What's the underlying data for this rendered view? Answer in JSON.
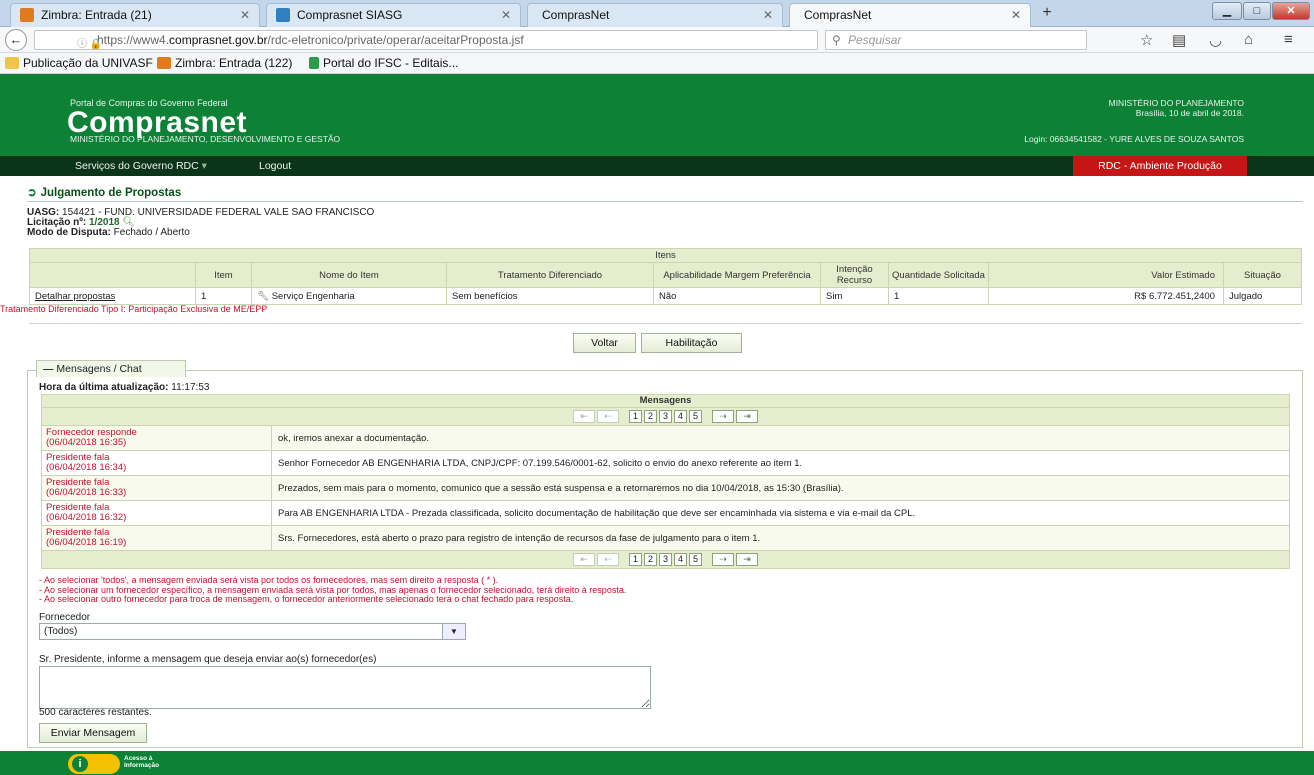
{
  "browser": {
    "tabs": [
      {
        "label": "Zimbra: Entrada (21)",
        "icon_color": "#e07a1f"
      },
      {
        "label": "Comprasnet SIASG",
        "icon_color": "#2f7fc1"
      },
      {
        "label": "ComprasNet",
        "icon_color": ""
      },
      {
        "label": "ComprasNet",
        "icon_color": ""
      }
    ],
    "active_tab": 3,
    "url_prefix": "https://www4.",
    "url_domain": "comprasnet.gov.br",
    "url_path": "/rdc-eletronico/private/operar/aceitarProposta.jsf",
    "search_placeholder": "Pesquisar",
    "bookmarks": [
      {
        "label": "Publicação da UNIVASF",
        "icon": "folder-icon"
      },
      {
        "label": "Zimbra: Entrada (122)",
        "icon": "zimbra-icon"
      },
      {
        "label": "Portal do IFSC - Editais...",
        "icon": "ifsc-icon"
      }
    ]
  },
  "header": {
    "portal": "Portal de Compras do Governo Federal",
    "brand": "Comprasnet",
    "ministry": "MINISTÉRIO DO PLANEJAMENTO, DESENVOLVIMENTO E GESTÃO",
    "ministry_right": "MINISTÉRIO DO PLANEJAMENTO",
    "date": "Brasília, 10 de abril de 2018.",
    "login": "Login: 06634541582 - YURE ALVES DE SOUZA SANTOS",
    "brand_color": "#0d8237"
  },
  "menu": {
    "services": "Serviços do Governo RDC",
    "logout": "Logout",
    "environment": "RDC - Ambiente Produção"
  },
  "page": {
    "title": "Julgamento de Propostas",
    "uasg_label": "UASG:",
    "uasg_value": "154421 - FUND. UNIVERSIDADE FEDERAL VALE SAO FRANCISCO",
    "licitacao_label": "Licitação nº:",
    "licitacao_value": "1/2018",
    "modo_label": "Modo de Disputa:",
    "modo_value": "Fechado / Aberto"
  },
  "itens": {
    "caption": "Itens",
    "headers": [
      "",
      "Item",
      "Nome do Item",
      "Tratamento Diferenciado",
      "Aplicabilidade Margem Preferência",
      "Intenção Recurso",
      "Quantidade Solicitada",
      "Valor Estimado",
      "Situação"
    ],
    "row": {
      "link": "Detalhar propostas",
      "item": "1",
      "nome": "Serviço Engenharia",
      "tratamento": "Sem benefícios",
      "margem": "Não",
      "intencao": "Sim",
      "quantidade": "1",
      "valor": "R$ 6.772.451,2400",
      "situacao": "Julgado"
    },
    "note": "Tratamento Diferenciado Tipo I: Participação Exclusiva de ME/EPP"
  },
  "buttons": {
    "voltar": "Voltar",
    "habilitacao": "Habilitação",
    "enviar": "Enviar Mensagem"
  },
  "chat": {
    "tab_label": "Mensagens / Chat",
    "hora_label": "Hora da última atualização:",
    "hora_value": "11:17:53",
    "table_caption": "Mensagens",
    "pages": [
      "1",
      "2",
      "3",
      "4",
      "5"
    ],
    "messages": [
      {
        "sender": "Fornecedor responde",
        "date": "(06/04/2018 16:35)",
        "text": "ok, iremos anexar a documentação."
      },
      {
        "sender": "Presidente fala",
        "date": "(06/04/2018 16:34)",
        "text": "Senhor Fornecedor AB ENGENHARIA LTDA, CNPJ/CPF: 07.199.546/0001-62, solicito o envio do anexo referente ao item 1."
      },
      {
        "sender": "Presidente fala",
        "date": "(06/04/2018 16:33)",
        "text": "Prezados, sem mais para o momento, comunico que a sessão está suspensa e a retornaremos no dia 10/04/2018, as 15:30 (Brasília)."
      },
      {
        "sender": "Presidente fala",
        "date": "(06/04/2018 16:32)",
        "text": "Para AB ENGENHARIA LTDA - Prezada classificada, solicito documentação de habilitação que deve ser encaminhada via sistema e via e-mail da CPL."
      },
      {
        "sender": "Presidente fala",
        "date": "(06/04/2018 16:19)",
        "text": "Srs. Fornecedores, está aberto o prazo para registro de intenção de recursos da fase de julgamento para o item 1."
      }
    ],
    "warnings": [
      "- Ao selecionar 'todos', a mensagem enviada será vista por todos os fornecedores, mas sem direito a resposta ( * ).",
      "- Ao selecionar um fornecedor específico, a mensagem enviada será vista por todos, mas apenas o fornecedor selecionado, terá direito à resposta.",
      "- Ao selecionar outro fornecedor para troca de mensagem, o fornecedor anteriormente  selecionado terá o chat fechado para resposta."
    ],
    "fornecedor_label": "Fornecedor",
    "fornecedor_value": "(Todos)",
    "message_label": "Sr. Presidente, informe a mensagem que deseja enviar ao(s) fornecedor(es)",
    "chars_left": "500 caracteres restantes."
  },
  "footer": {
    "acesso_line1": "Acesso à",
    "acesso_line2": "Informação"
  }
}
